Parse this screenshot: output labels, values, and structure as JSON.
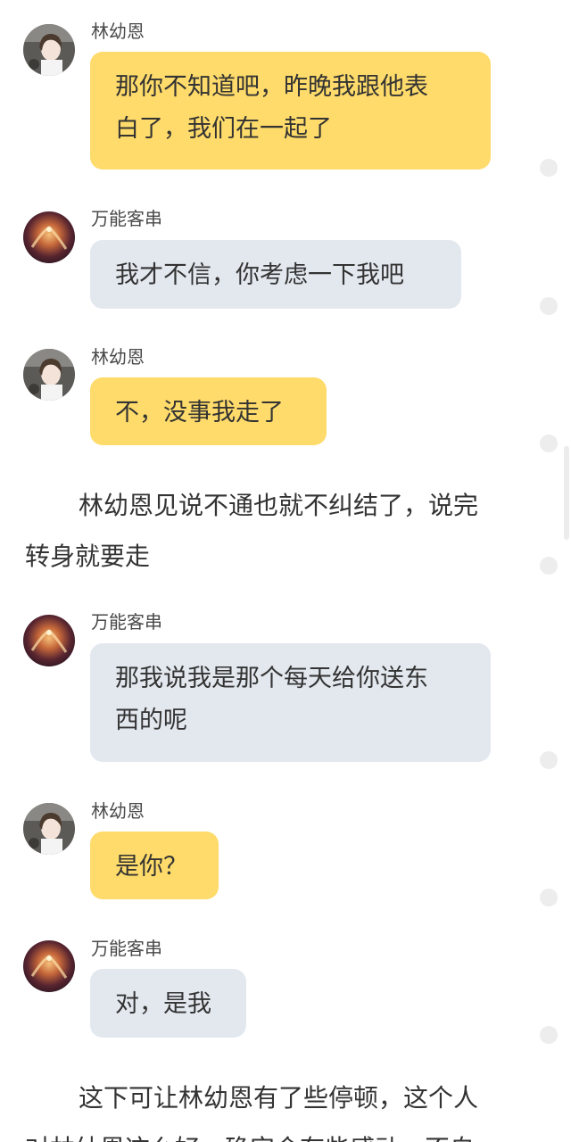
{
  "colors": {
    "heroine_bubble": "#fedb6a",
    "hero_bubble": "#e3e8ef",
    "text": "#333333"
  },
  "messages": [
    {
      "sender": "林幼恩",
      "lines": [
        "那你不知道吧，昨晚我跟他表",
        "白了，我们在一起了"
      ]
    },
    {
      "sender": "万能客串",
      "lines": [
        "我才不信，你考虑一下我吧"
      ]
    },
    {
      "sender": "林幼恩",
      "lines": [
        "不，没事我走了"
      ]
    },
    {
      "sender": "万能客串",
      "lines": [
        "那我说我是那个每天给你送东",
        "西的呢"
      ]
    },
    {
      "sender": "林幼恩",
      "lines": [
        "是你？"
      ]
    },
    {
      "sender": "万能客串",
      "lines": [
        "对，是我"
      ]
    }
  ],
  "narrations": [
    {
      "lines": [
        "林幼恩见说不通也就不纠结了，说完",
        "转身就要走"
      ]
    },
    {
      "lines": [
        "这下可让林幼恩有了些停顿，这个人",
        "对林幼恩这么好，确实会有些感动，不自"
      ]
    }
  ]
}
